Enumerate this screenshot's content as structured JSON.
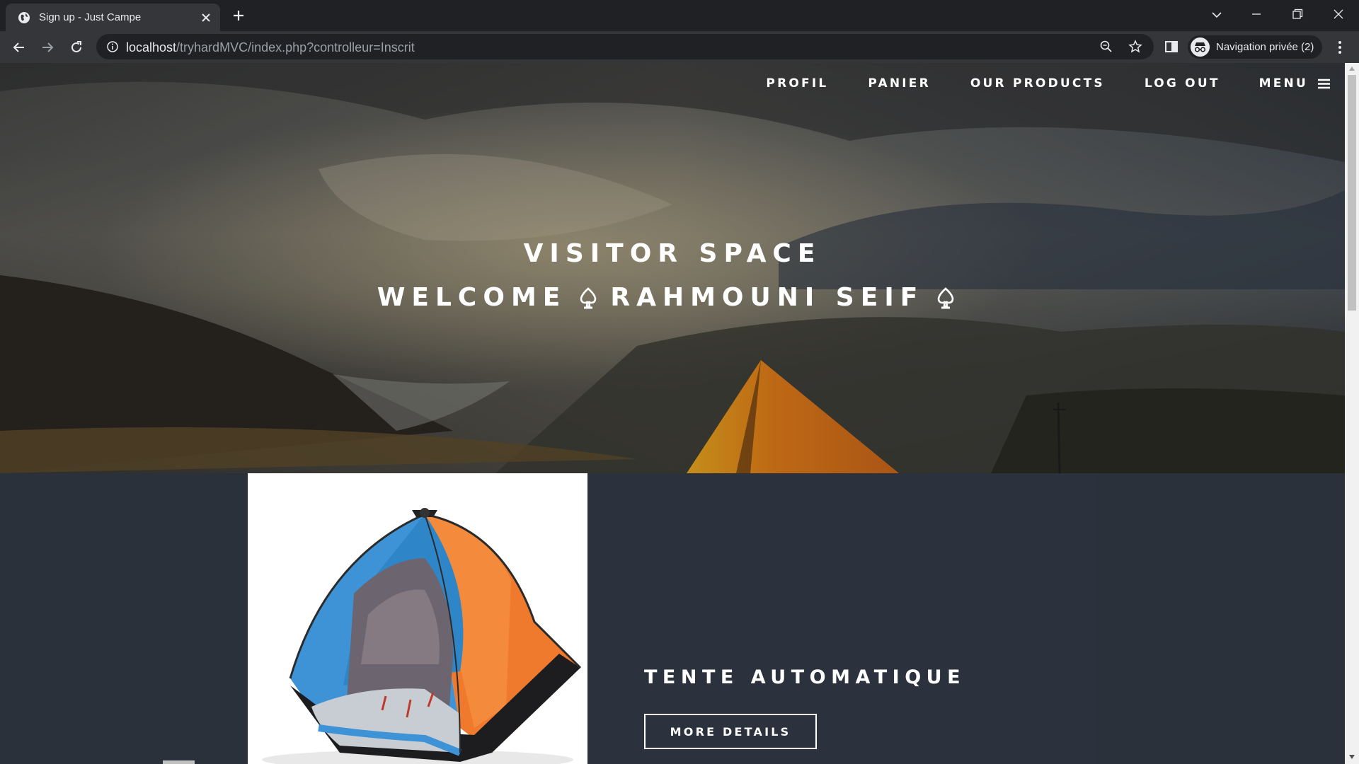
{
  "browser": {
    "tab_title": "Sign up - Just Campe",
    "url_host": "localhost",
    "url_path": "/tryhardMVC/index.php?controlleur=Inscrit",
    "profile_label": "Navigation privée (2)"
  },
  "nav": {
    "items": [
      "PROFIL",
      "PANIER",
      "OUR PRODUCTS",
      "LOG OUT"
    ],
    "menu_label": "MENU"
  },
  "hero": {
    "title": "VISITOR SPACE",
    "welcome_prefix": "WELCOME",
    "user_name": "RAHMOUNI SEIF"
  },
  "product": {
    "title": "TENTE AUTOMATIQUE",
    "button_label": "MORE DETAILS"
  },
  "colors": {
    "chrome_dark": "#202124",
    "chrome_toolbar": "#35363a",
    "section_bg": "#2b313b",
    "text_white": "#ffffff"
  },
  "icons": [
    "globe-icon",
    "close-icon",
    "plus-icon",
    "chevron-down-icon",
    "minimize-icon",
    "restore-icon",
    "back-icon",
    "forward-icon",
    "reload-icon",
    "info-icon",
    "zoom-icon",
    "star-icon",
    "side-panel-icon",
    "incognito-icon",
    "kebab-menu-icon",
    "hamburger-icon",
    "spade-icon"
  ]
}
